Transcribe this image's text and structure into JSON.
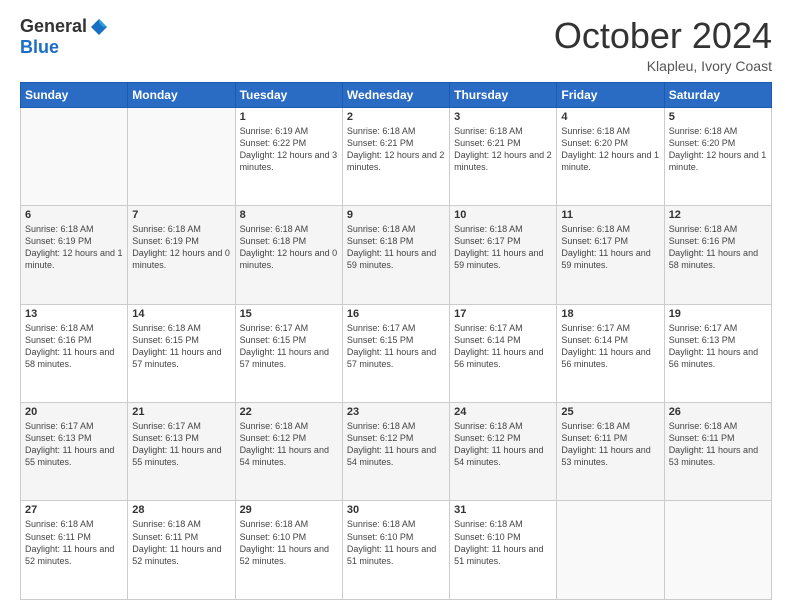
{
  "header": {
    "logo_general": "General",
    "logo_blue": "Blue",
    "month_title": "October 2024",
    "location": "Klapleu, Ivory Coast"
  },
  "days_of_week": [
    "Sunday",
    "Monday",
    "Tuesday",
    "Wednesday",
    "Thursday",
    "Friday",
    "Saturday"
  ],
  "weeks": [
    [
      {
        "num": "",
        "detail": ""
      },
      {
        "num": "",
        "detail": ""
      },
      {
        "num": "1",
        "detail": "Sunrise: 6:19 AM\nSunset: 6:22 PM\nDaylight: 12 hours and 3 minutes."
      },
      {
        "num": "2",
        "detail": "Sunrise: 6:18 AM\nSunset: 6:21 PM\nDaylight: 12 hours and 2 minutes."
      },
      {
        "num": "3",
        "detail": "Sunrise: 6:18 AM\nSunset: 6:21 PM\nDaylight: 12 hours and 2 minutes."
      },
      {
        "num": "4",
        "detail": "Sunrise: 6:18 AM\nSunset: 6:20 PM\nDaylight: 12 hours and 1 minute."
      },
      {
        "num": "5",
        "detail": "Sunrise: 6:18 AM\nSunset: 6:20 PM\nDaylight: 12 hours and 1 minute."
      }
    ],
    [
      {
        "num": "6",
        "detail": "Sunrise: 6:18 AM\nSunset: 6:19 PM\nDaylight: 12 hours and 1 minute."
      },
      {
        "num": "7",
        "detail": "Sunrise: 6:18 AM\nSunset: 6:19 PM\nDaylight: 12 hours and 0 minutes."
      },
      {
        "num": "8",
        "detail": "Sunrise: 6:18 AM\nSunset: 6:18 PM\nDaylight: 12 hours and 0 minutes."
      },
      {
        "num": "9",
        "detail": "Sunrise: 6:18 AM\nSunset: 6:18 PM\nDaylight: 11 hours and 59 minutes."
      },
      {
        "num": "10",
        "detail": "Sunrise: 6:18 AM\nSunset: 6:17 PM\nDaylight: 11 hours and 59 minutes."
      },
      {
        "num": "11",
        "detail": "Sunrise: 6:18 AM\nSunset: 6:17 PM\nDaylight: 11 hours and 59 minutes."
      },
      {
        "num": "12",
        "detail": "Sunrise: 6:18 AM\nSunset: 6:16 PM\nDaylight: 11 hours and 58 minutes."
      }
    ],
    [
      {
        "num": "13",
        "detail": "Sunrise: 6:18 AM\nSunset: 6:16 PM\nDaylight: 11 hours and 58 minutes."
      },
      {
        "num": "14",
        "detail": "Sunrise: 6:18 AM\nSunset: 6:15 PM\nDaylight: 11 hours and 57 minutes."
      },
      {
        "num": "15",
        "detail": "Sunrise: 6:17 AM\nSunset: 6:15 PM\nDaylight: 11 hours and 57 minutes."
      },
      {
        "num": "16",
        "detail": "Sunrise: 6:17 AM\nSunset: 6:15 PM\nDaylight: 11 hours and 57 minutes."
      },
      {
        "num": "17",
        "detail": "Sunrise: 6:17 AM\nSunset: 6:14 PM\nDaylight: 11 hours and 56 minutes."
      },
      {
        "num": "18",
        "detail": "Sunrise: 6:17 AM\nSunset: 6:14 PM\nDaylight: 11 hours and 56 minutes."
      },
      {
        "num": "19",
        "detail": "Sunrise: 6:17 AM\nSunset: 6:13 PM\nDaylight: 11 hours and 56 minutes."
      }
    ],
    [
      {
        "num": "20",
        "detail": "Sunrise: 6:17 AM\nSunset: 6:13 PM\nDaylight: 11 hours and 55 minutes."
      },
      {
        "num": "21",
        "detail": "Sunrise: 6:17 AM\nSunset: 6:13 PM\nDaylight: 11 hours and 55 minutes."
      },
      {
        "num": "22",
        "detail": "Sunrise: 6:18 AM\nSunset: 6:12 PM\nDaylight: 11 hours and 54 minutes."
      },
      {
        "num": "23",
        "detail": "Sunrise: 6:18 AM\nSunset: 6:12 PM\nDaylight: 11 hours and 54 minutes."
      },
      {
        "num": "24",
        "detail": "Sunrise: 6:18 AM\nSunset: 6:12 PM\nDaylight: 11 hours and 54 minutes."
      },
      {
        "num": "25",
        "detail": "Sunrise: 6:18 AM\nSunset: 6:11 PM\nDaylight: 11 hours and 53 minutes."
      },
      {
        "num": "26",
        "detail": "Sunrise: 6:18 AM\nSunset: 6:11 PM\nDaylight: 11 hours and 53 minutes."
      }
    ],
    [
      {
        "num": "27",
        "detail": "Sunrise: 6:18 AM\nSunset: 6:11 PM\nDaylight: 11 hours and 52 minutes."
      },
      {
        "num": "28",
        "detail": "Sunrise: 6:18 AM\nSunset: 6:11 PM\nDaylight: 11 hours and 52 minutes."
      },
      {
        "num": "29",
        "detail": "Sunrise: 6:18 AM\nSunset: 6:10 PM\nDaylight: 11 hours and 52 minutes."
      },
      {
        "num": "30",
        "detail": "Sunrise: 6:18 AM\nSunset: 6:10 PM\nDaylight: 11 hours and 51 minutes."
      },
      {
        "num": "31",
        "detail": "Sunrise: 6:18 AM\nSunset: 6:10 PM\nDaylight: 11 hours and 51 minutes."
      },
      {
        "num": "",
        "detail": ""
      },
      {
        "num": "",
        "detail": ""
      }
    ]
  ]
}
